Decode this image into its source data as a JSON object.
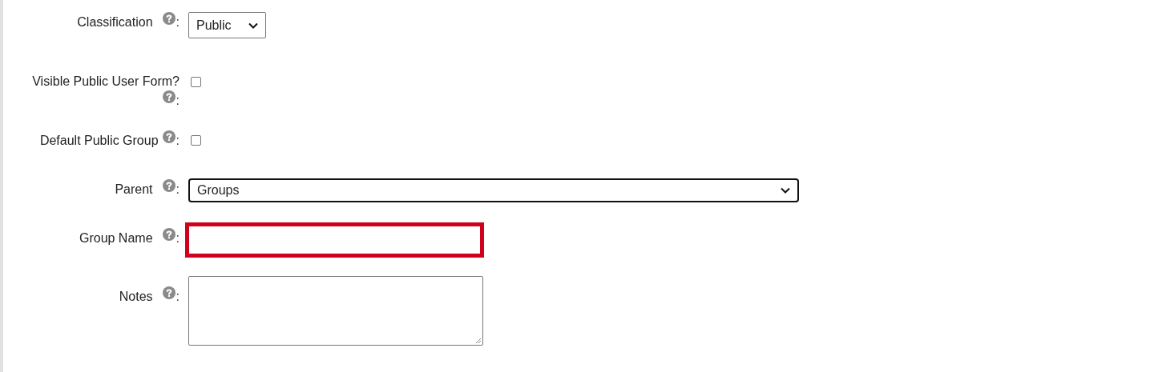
{
  "fields": [
    {
      "kind": "select",
      "label": "Classification",
      "colon": ":",
      "value": "Public",
      "focused": false,
      "wide": false
    },
    {
      "kind": "checkbox",
      "label": "Visible Public User Form?",
      "colon": ":",
      "checked": false
    },
    {
      "kind": "checkbox",
      "label": "Default Public Group",
      "colon": ":",
      "checked": false
    },
    {
      "kind": "select",
      "label": "Parent",
      "colon": ":",
      "value": "Groups",
      "focused": true,
      "wide": true
    },
    {
      "kind": "text",
      "label": "Group Name",
      "colon": ":",
      "invalid": true
    },
    {
      "kind": "textarea",
      "label": "Notes",
      "colon": ":"
    }
  ]
}
